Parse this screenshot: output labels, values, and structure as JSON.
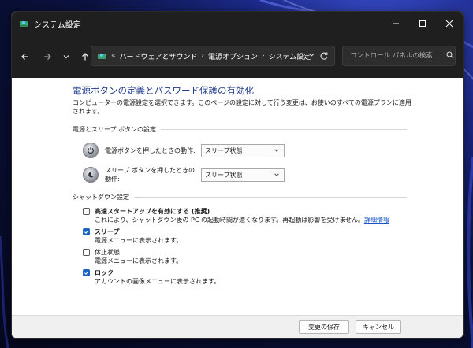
{
  "window": {
    "title": "システム設定"
  },
  "nav": {
    "back_icon": "arrow-left-icon",
    "forward_icon": "arrow-right-icon",
    "recent_icon": "chevron-down-icon",
    "up_icon": "arrow-up-icon"
  },
  "address": {
    "overflow": "«",
    "crumbs": [
      "ハードウェアとサウンド",
      "電源オプション",
      "システム設定"
    ],
    "separator": "›"
  },
  "search": {
    "placeholder": "コントロール パネルの検索"
  },
  "page": {
    "title": "電源ボタンの定義とパスワード保護の有効化",
    "description": "コンピューターの電源設定を選択できます。このページの設定に対して行う変更は、お使いのすべての電源プランに適用されます。"
  },
  "power_section": {
    "header": "電源とスリープ ボタンの設定",
    "rows": [
      {
        "label": "電源ボタンを押したときの動作:",
        "value": "スリープ状態"
      },
      {
        "label": "スリープ ボタンを押したときの動作:",
        "value": "スリープ状態"
      }
    ]
  },
  "shutdown_section": {
    "header": "シャットダウン設定",
    "items": [
      {
        "title": "高速スタートアップを有効にする (推奨)",
        "desc": "これにより、シャットダウン後の PC の起動時間が速くなります。再起動は影響を受けません。",
        "link": "詳細情報",
        "checked": false
      },
      {
        "title": "スリープ",
        "desc": "電源メニューに表示されます。",
        "checked": true
      },
      {
        "title": "休止状態",
        "desc": "電源メニューに表示されます。",
        "checked": false
      },
      {
        "title": "ロック",
        "desc": "アカウントの画像メニューに表示されます。",
        "checked": true
      }
    ]
  },
  "footer": {
    "save_label": "変更の保存",
    "cancel_label": "キャンセル"
  },
  "colors": {
    "title_blue": "#1f3a8a",
    "accent": "#1a63c7",
    "chrome": "#1f1f1f"
  }
}
